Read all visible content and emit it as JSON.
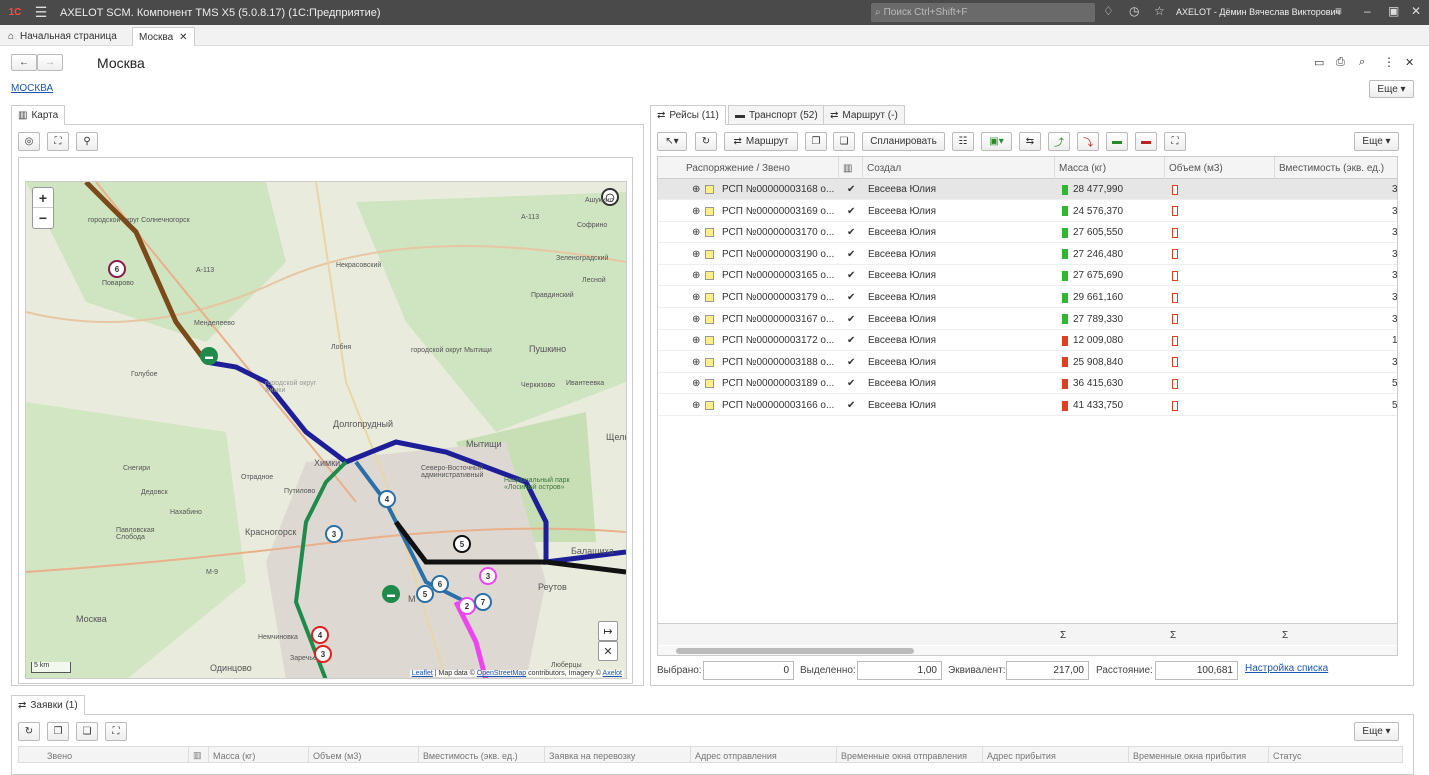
{
  "app": {
    "logo": "1С",
    "title": "AXELOT SCM. Компонент TMS X5 (5.0.8.17)  (1С:Предприятие)",
    "search_placeholder": "Поиск Ctrl+Shift+F",
    "user": "AXELOT - Дёмин Вячеслав Викторович"
  },
  "tabs": {
    "home": "Начальная страница",
    "current": "Москва"
  },
  "page": {
    "title": "Москва",
    "link": "МОСКВА",
    "more": "Еще"
  },
  "map": {
    "tab": "Карта",
    "scale": "5 km",
    "attribution_leaflet": "Leaflet",
    "attribution_mid": " | Map data © ",
    "attribution_osm": "OpenStreetMap",
    "attribution_end": " contributors, Imagery © ",
    "attribution_axelot": "Axelot",
    "labels": [
      "городской округ Солнечногорск",
      "А-113",
      "Некрасовский",
      "Зеленоградский",
      "Лесной",
      "Поварово",
      "Правдинский",
      "Менделеево",
      "Лобня",
      "городской округ Мытищи",
      "Пушкино",
      "Голубое",
      "Черкизово",
      "Ивантеевка",
      "Долгопрудный",
      "Мытищи",
      "Щелково",
      "Химки",
      "Северо-Восточный административный",
      "Национальный парк «Лосиный остров»",
      "Снегири",
      "Путилово",
      "Дедовск",
      "Нахабино",
      "Красногорск",
      "Павловская Слобода",
      "Реутов",
      "Балашиха",
      "М-9",
      "Москва",
      "Немчиновка",
      "Заречье",
      "Одинцово",
      "Люберцы",
      "Ашукино",
      "Софрино",
      "А-113",
      "М",
      "Отрадное",
      "городской округ Химки"
    ],
    "pins": [
      "6",
      "4",
      "3",
      "5",
      "5",
      "6",
      "3",
      "2",
      "7",
      "4",
      "3",
      "1"
    ]
  },
  "right_tabs": [
    {
      "label": "Рейсы (11)"
    },
    {
      "label": "Транспорт (52)"
    },
    {
      "label": "Маршрут (-)"
    }
  ],
  "toolbar": {
    "route": "Маршрут",
    "plan": "Спланировать",
    "more": "Еще"
  },
  "grid": {
    "headers": [
      "Распоряжение / Звено",
      "Создал",
      "Масса (кг)",
      "Объем (м3)",
      "Вместимость (экв. ед.)"
    ],
    "rows": [
      {
        "doc": "РСП №00000003168 о...",
        "creator": "Евсеева Юлия",
        "mass": "28 477,990",
        "status": "green",
        "cap": "3"
      },
      {
        "doc": "РСП №00000003169 о...",
        "creator": "Евсеева Юлия",
        "mass": "24 576,370",
        "status": "green",
        "cap": "3"
      },
      {
        "doc": "РСП №00000003170 о...",
        "creator": "Евсеева Юлия",
        "mass": "27 605,550",
        "status": "green",
        "cap": "3"
      },
      {
        "doc": "РСП №00000003190 о...",
        "creator": "Евсеева Юлия",
        "mass": "27 246,480",
        "status": "green",
        "cap": "3"
      },
      {
        "doc": "РСП №00000003165 о...",
        "creator": "Евсеева Юлия",
        "mass": "27 675,690",
        "status": "green",
        "cap": "3"
      },
      {
        "doc": "РСП №00000003179 о...",
        "creator": "Евсеева Юлия",
        "mass": "29 661,160",
        "status": "green",
        "cap": "3"
      },
      {
        "doc": "РСП №00000003167 о...",
        "creator": "Евсеева Юлия",
        "mass": "27 789,330",
        "status": "green",
        "cap": "3"
      },
      {
        "doc": "РСП №00000003172 о...",
        "creator": "Евсеева Юлия",
        "mass": "12 009,080",
        "status": "red",
        "cap": "1"
      },
      {
        "doc": "РСП №00000003188 о...",
        "creator": "Евсеева Юлия",
        "mass": "25 908,840",
        "status": "red",
        "cap": "3"
      },
      {
        "doc": "РСП №00000003189 о...",
        "creator": "Евсеева Юлия",
        "mass": "36 415,630",
        "status": "red",
        "cap": "5"
      },
      {
        "doc": "РСП №00000003166 о...",
        "creator": "Евсеева Юлия",
        "mass": "41 433,750",
        "status": "red",
        "cap": "5"
      }
    ],
    "sum": "Σ"
  },
  "summary": {
    "selected_label": "Выбрано:",
    "selected": "0",
    "highlighted_label": "Выделенно:",
    "highlighted": "1,00",
    "equiv_label": "Эквивалент:",
    "equiv": "217,00",
    "distance_label": "Расстояние:",
    "distance": "100,681",
    "settings": "Настройка списка"
  },
  "bottom": {
    "tab": "Заявки (1)",
    "more": "Еще",
    "headers": [
      "Звено",
      "Масса (кг)",
      "Объем (м3)",
      "Вместимость (экв. ед.)",
      "Заявка на перевозку",
      "Адрес отправления",
      "Временные окна отправления",
      "Адрес прибытия",
      "Временные окна прибытия",
      "Статус"
    ]
  }
}
